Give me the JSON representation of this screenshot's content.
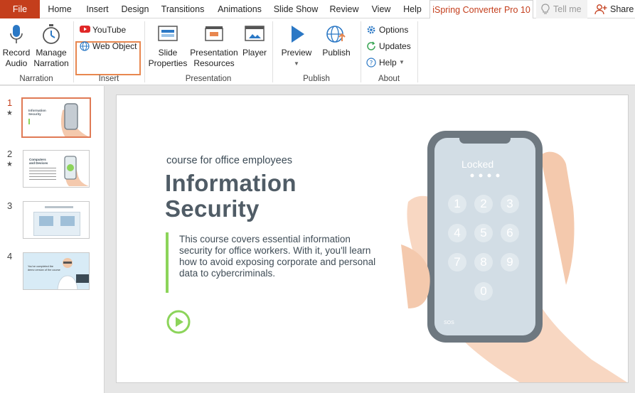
{
  "tabs": {
    "file": "File",
    "home": "Home",
    "insert": "Insert",
    "design": "Design",
    "transitions": "Transitions",
    "animations": "Animations",
    "slide_show": "Slide Show",
    "review": "Review",
    "view": "View",
    "help": "Help",
    "ispring": "iSpring Converter Pro 10",
    "tell_me": "Tell me",
    "share": "Share"
  },
  "ribbon": {
    "narration": {
      "label": "Narration",
      "record_line1": "Record",
      "record_line2": "Audio",
      "manage_line1": "Manage",
      "manage_line2": "Narration"
    },
    "insert": {
      "label": "Insert",
      "youtube": "YouTube",
      "web_object": "Web Object"
    },
    "presentation": {
      "label": "Presentation",
      "slide_props_line1": "Slide",
      "slide_props_line2": "Properties",
      "pres_res_line1": "Presentation",
      "pres_res_line2": "Resources",
      "player": "Player"
    },
    "publish": {
      "label": "Publish",
      "preview": "Preview",
      "publish": "Publish"
    },
    "about": {
      "label": "About",
      "options": "Options",
      "updates": "Updates",
      "help": "Help"
    }
  },
  "thumbnails": [
    {
      "num": "1",
      "star": "★",
      "title_line1": "Information",
      "title_line2": "Security"
    },
    {
      "num": "2",
      "star": "★",
      "title_line1": "Computers",
      "title_line2": "and Devices"
    },
    {
      "num": "3",
      "star": ""
    },
    {
      "num": "4",
      "star": "",
      "caption_line1": "You've completed the",
      "caption_line2": "demo version of the course"
    }
  ],
  "slide": {
    "course": "course for office employees",
    "title_line1": "Information",
    "title_line2": "Security",
    "description": "This course covers essential information security for office workers. With it, you'll learn how to avoid exposing corporate and personal data to cybercriminals.",
    "phone": {
      "locked": "Locked",
      "keys": [
        "1",
        "2",
        "3",
        "4",
        "5",
        "6",
        "7",
        "8",
        "9",
        "0"
      ],
      "sos": "SOS"
    }
  },
  "colors": {
    "accent": "#c43e1c",
    "highlight": "#e8874f",
    "green": "#8cd45a"
  }
}
